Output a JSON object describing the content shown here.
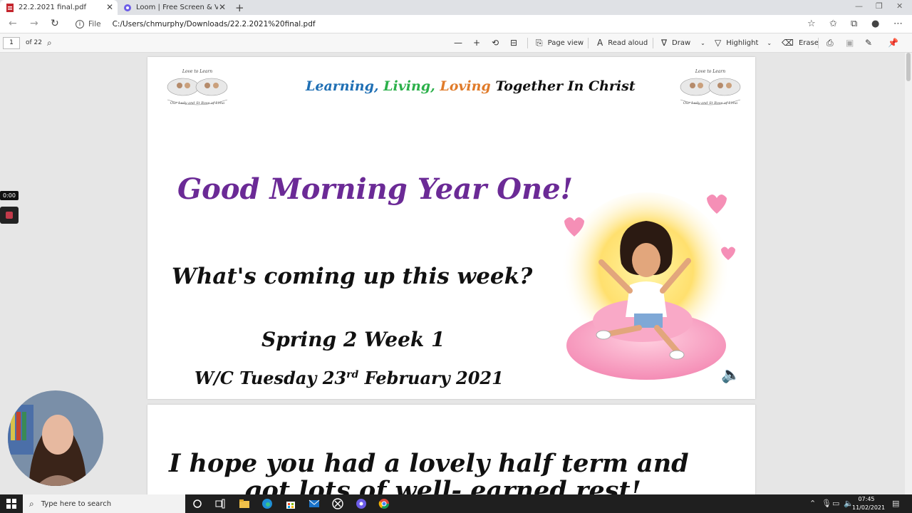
{
  "browser": {
    "tabs": [
      {
        "title": "22.2.2021 final.pdf",
        "active": true
      },
      {
        "title": "Loom | Free Screen & Video Rec",
        "active": false
      }
    ],
    "url": {
      "scheme_label": "File",
      "path": "C:/Users/chmurphy/Downloads/22.2.2021%20final.pdf"
    }
  },
  "pdf_toolbar": {
    "page_number": "1",
    "page_count": "of 22",
    "page_view": "Page view",
    "read_aloud": "Read aloud",
    "draw": "Draw",
    "highlight": "Highlight",
    "erase": "Erase"
  },
  "slide1": {
    "motto": {
      "w1": "Learning,",
      "w2": "Living,",
      "w3": "Loving",
      "rest": "Together In Christ"
    },
    "greeting": "Good Morning Year One!",
    "question": "What's coming up this week?",
    "week": "Spring 2 Week 1",
    "wc_prefix": "W/C Tuesday 23",
    "wc_sup": "rd",
    "wc_suffix": " February 2021"
  },
  "slide2": {
    "line1": "I hope you had a lovely half term and",
    "line2": "got lots of well- earned rest!"
  },
  "loom": {
    "timer": "0:00"
  },
  "taskbar": {
    "search_placeholder": "Type here to search",
    "time": "07:45",
    "date": "11/02/2021"
  },
  "colors": {
    "motto_blue": "#1f6fb4",
    "motto_green": "#2bb04a",
    "motto_orange": "#e07b2a",
    "greeting_purple": "#6b2a96"
  }
}
